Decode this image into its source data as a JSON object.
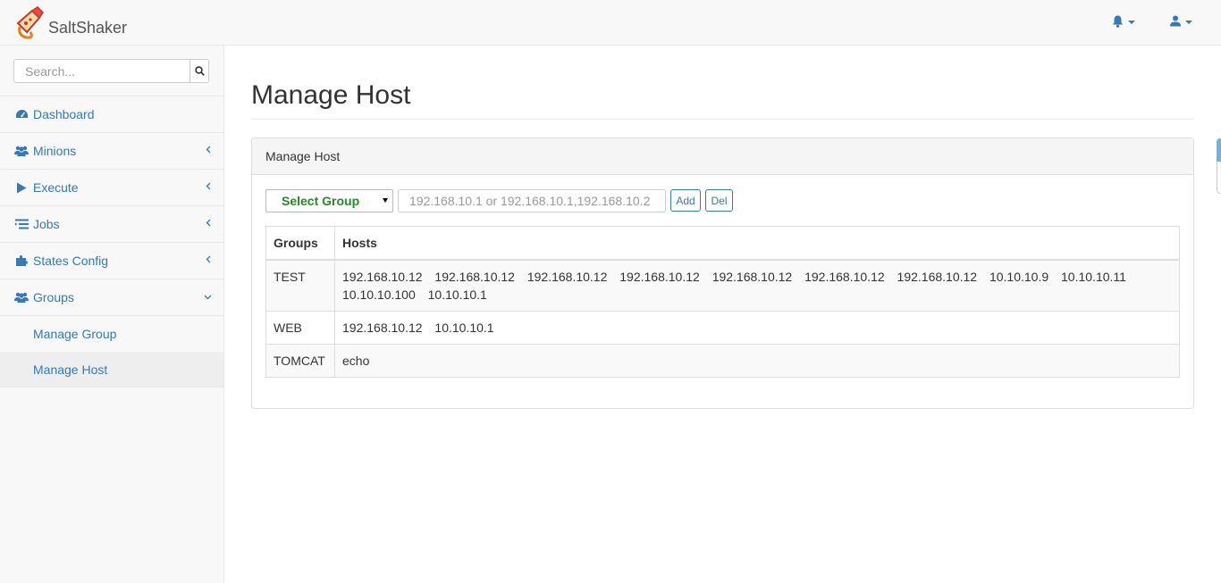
{
  "app": {
    "brand_name": "SaltShaker"
  },
  "navbar": {
    "icons": [
      "bell-icon",
      "user-icon"
    ]
  },
  "sidebar": {
    "search_placeholder": "Search...",
    "items": [
      {
        "label": "Dashboard",
        "icon": "dashboard-icon"
      },
      {
        "label": "Minions",
        "icon": "users-icon",
        "expandable": true
      },
      {
        "label": "Execute",
        "icon": "play-icon",
        "expandable": true
      },
      {
        "label": "Jobs",
        "icon": "tasks-icon",
        "expandable": true
      },
      {
        "label": "States Config",
        "icon": "puzzle-icon",
        "expandable": true
      },
      {
        "label": "Groups",
        "icon": "users-icon",
        "expandable": true,
        "expanded": true
      }
    ],
    "subitems": [
      {
        "label": "Manage Group"
      },
      {
        "label": "Manage Host",
        "active": true
      }
    ]
  },
  "main": {
    "page_title": "Manage Host",
    "panel_title": "Manage Host",
    "form": {
      "select_value": "Select Group",
      "hosts_placeholder": "192.168.10.1 or 192.168.10.1,192.168.10.2",
      "add_label": "Add",
      "del_label": "Del"
    },
    "table": {
      "headers": [
        "Groups",
        "Hosts"
      ],
      "rows": [
        {
          "group": "TEST",
          "hosts": [
            "192.168.10.12",
            "192.168.10.12",
            "192.168.10.12",
            "192.168.10.12",
            "192.168.10.12",
            "192.168.10.12",
            "192.168.10.12",
            "10.10.10.9",
            "10.10.10.11",
            "10.10.10.100",
            "10.10.10.1"
          ]
        },
        {
          "group": "WEB",
          "hosts": [
            "192.168.10.12",
            "10.10.10.1"
          ]
        },
        {
          "group": "TOMCAT",
          "hosts": [
            "echo"
          ]
        }
      ]
    }
  },
  "colors": {
    "link": "#337ab7",
    "select_text": "#228b22",
    "sidebar_bg": "#f8f8f8",
    "active_bg": "#eeeeee"
  }
}
